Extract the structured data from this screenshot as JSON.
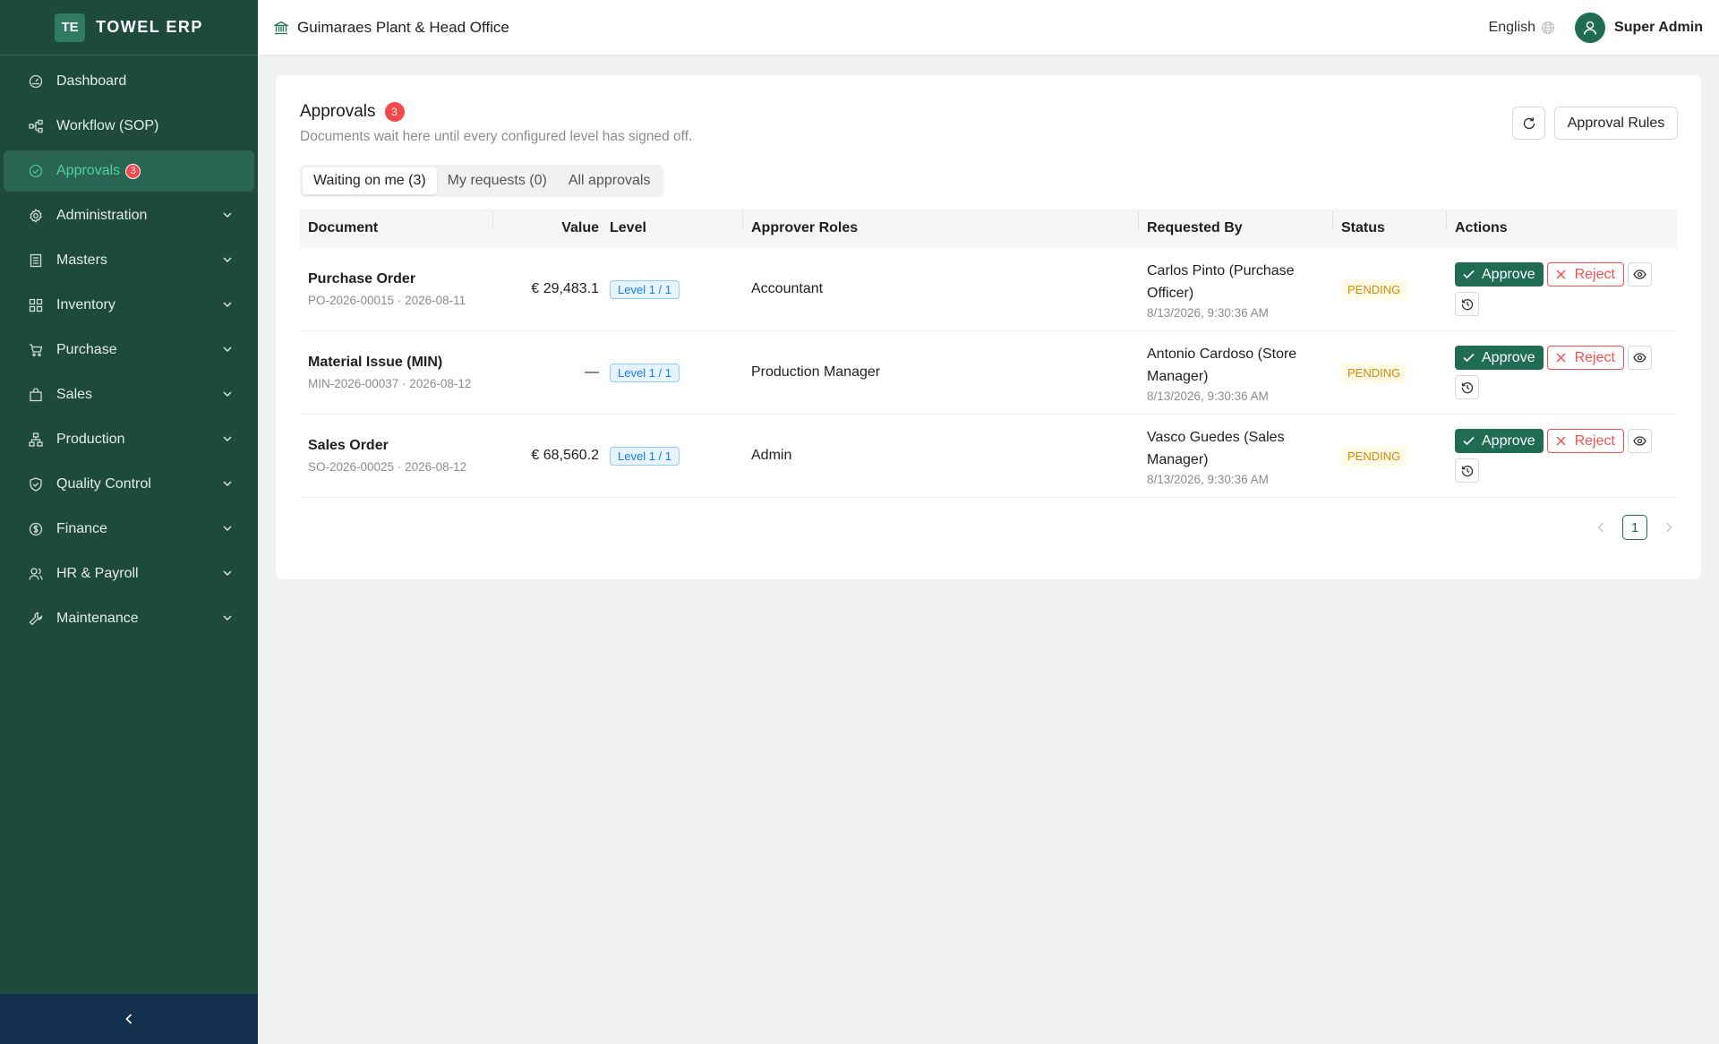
{
  "app": {
    "logo_text": "TE",
    "name": "TOWEL ERP",
    "collapse_icon": "chevron-left-icon"
  },
  "sidebar": {
    "items": [
      {
        "label": "Dashboard",
        "icon": "dashboard-icon",
        "active": false,
        "expandable": false
      },
      {
        "label": "Workflow (SOP)",
        "icon": "workflow-icon",
        "active": false,
        "expandable": false
      },
      {
        "label": "Approvals",
        "icon": "check-circle-icon",
        "active": true,
        "expandable": false,
        "badge": "3"
      },
      {
        "label": "Administration",
        "icon": "gear-icon",
        "active": false,
        "expandable": true
      },
      {
        "label": "Masters",
        "icon": "book-icon",
        "active": false,
        "expandable": true
      },
      {
        "label": "Inventory",
        "icon": "grid-icon",
        "active": false,
        "expandable": true
      },
      {
        "label": "Purchase",
        "icon": "cart-icon",
        "active": false,
        "expandable": true
      },
      {
        "label": "Sales",
        "icon": "bag-icon",
        "active": false,
        "expandable": true
      },
      {
        "label": "Production",
        "icon": "cluster-icon",
        "active": false,
        "expandable": true
      },
      {
        "label": "Quality Control",
        "icon": "shield-check-icon",
        "active": false,
        "expandable": true
      },
      {
        "label": "Finance",
        "icon": "dollar-icon",
        "active": false,
        "expandable": true
      },
      {
        "label": "HR & Payroll",
        "icon": "users-icon",
        "active": false,
        "expandable": true
      },
      {
        "label": "Maintenance",
        "icon": "tool-icon",
        "active": false,
        "expandable": true
      }
    ]
  },
  "header": {
    "site_name": "Guimaraes Plant & Head Office",
    "language": "English",
    "user_name": "Super Admin"
  },
  "page": {
    "title": "Approvals",
    "badge": "3",
    "subtitle": "Documents wait here until every configured level has signed off.",
    "rules_button": "Approval Rules",
    "tabs": [
      {
        "label": "Waiting on me (3)",
        "active": true
      },
      {
        "label": "My requests (0)",
        "active": false
      },
      {
        "label": "All approvals",
        "active": false
      }
    ]
  },
  "table": {
    "columns": [
      "Document",
      "Value",
      "Level",
      "Approver Roles",
      "Requested By",
      "Status",
      "Actions"
    ],
    "rows": [
      {
        "doc_type": "Purchase Order",
        "doc_ref": "PO-2026-00015 · 2026-08-11",
        "value": "€ 29,483.1",
        "level": "Level 1 / 1",
        "roles": "Accountant",
        "requested_by": "Carlos Pinto (Purchase Officer)",
        "requested_at": "8/13/2026, 9:30:36 AM",
        "status": "PENDING"
      },
      {
        "doc_type": "Material Issue (MIN)",
        "doc_ref": "MIN-2026-00037 · 2026-08-12",
        "value": "—",
        "level": "Level 1 / 1",
        "roles": "Production Manager",
        "requested_by": "Antonio Cardoso (Store Manager)",
        "requested_at": "8/13/2026, 9:30:36 AM",
        "status": "PENDING"
      },
      {
        "doc_type": "Sales Order",
        "doc_ref": "SO-2026-00025 · 2026-08-12",
        "value": "€ 68,560.2",
        "level": "Level 1 / 1",
        "roles": "Admin",
        "requested_by": "Vasco Guedes (Sales Manager)",
        "requested_at": "8/13/2026, 9:30:36 AM",
        "status": "PENDING"
      }
    ],
    "actions": {
      "approve": "Approve",
      "reject": "Reject"
    }
  },
  "pagination": {
    "current": "1"
  },
  "colors": {
    "sidebar": "#1e4a3e",
    "accent": "#1f6b54",
    "active_text": "#4fd39a",
    "danger": "#ff4d4f",
    "pending": "#d48806"
  }
}
